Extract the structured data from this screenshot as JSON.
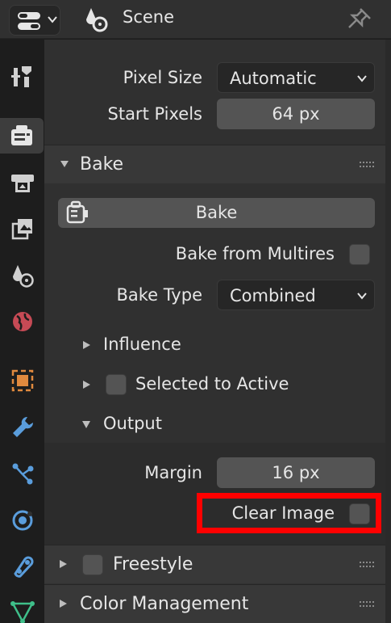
{
  "header": {
    "title": "Scene",
    "editor_icon": "properties-editor-icon",
    "scene_icon": "scene-icon",
    "pin_icon": "pin-icon"
  },
  "sidebar_tabs": [
    {
      "name": "tool",
      "icon": "tool-icon",
      "active": false
    },
    {
      "name": "render",
      "icon": "render-icon",
      "active": true
    },
    {
      "name": "output",
      "icon": "output-icon",
      "active": false
    },
    {
      "name": "view-layer",
      "icon": "view-layer-icon",
      "active": false
    },
    {
      "name": "scene",
      "icon": "scene-icon",
      "active": false
    },
    {
      "name": "world",
      "icon": "world-icon",
      "active": false
    },
    {
      "name": "object",
      "icon": "object-icon",
      "active": false
    },
    {
      "name": "modifiers",
      "icon": "wrench-icon",
      "active": false
    },
    {
      "name": "particles",
      "icon": "particles-icon",
      "active": false
    },
    {
      "name": "physics",
      "icon": "physics-icon",
      "active": false
    },
    {
      "name": "constraints",
      "icon": "constraints-icon",
      "active": false
    },
    {
      "name": "data",
      "icon": "mesh-data-icon",
      "active": false
    }
  ],
  "pixel": {
    "size_label": "Pixel Size",
    "size_value": "Automatic",
    "start_label": "Start Pixels",
    "start_value": "64 px"
  },
  "bake": {
    "section_title": "Bake",
    "button_label": "Bake",
    "multires_label": "Bake from Multires",
    "multires_checked": false,
    "type_label": "Bake Type",
    "type_value": "Combined",
    "influence_label": "Influence",
    "selected_to_active_label": "Selected to Active",
    "selected_to_active_checked": false,
    "output_label": "Output",
    "margin_label": "Margin",
    "margin_value": "16 px",
    "clear_image_label": "Clear Image",
    "clear_image_checked": false
  },
  "freestyle": {
    "title": "Freestyle",
    "checked": false
  },
  "color_management": {
    "title": "Color Management"
  },
  "colors": {
    "highlight": "#ff0000",
    "panel_bg": "#303030",
    "header_bg": "#383838",
    "field_bg": "#545454"
  }
}
